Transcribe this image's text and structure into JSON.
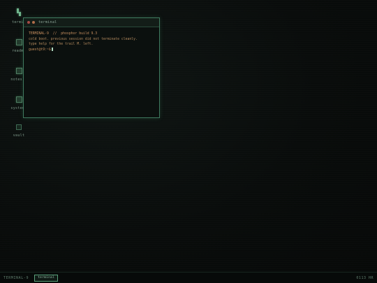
{
  "desktop": {
    "icons": [
      {
        "label": "termin",
        "icon": "terminal-icon"
      },
      {
        "label": "readme",
        "icon": "file-icon"
      },
      {
        "label": "notes.t",
        "icon": "file-icon"
      },
      {
        "label": "system.",
        "icon": "file-icon"
      },
      {
        "label": "vault",
        "icon": "folder-icon"
      }
    ]
  },
  "terminal": {
    "title": "terminal",
    "lines": [
      "TERMINAL-9  //  phosphor build 9.3",
      "cold boot. previous session did not terminate cleanly.",
      "type help for the trail M. left."
    ],
    "prompt": "guest@t9:~$"
  },
  "taskbar": {
    "brand": "TERMINAL-9",
    "task_button": "terminal",
    "clock": "0113 HR"
  },
  "colors": {
    "accent": "#5aa07a",
    "terminal_text": "#b38a5e",
    "background": "#080b0a"
  }
}
